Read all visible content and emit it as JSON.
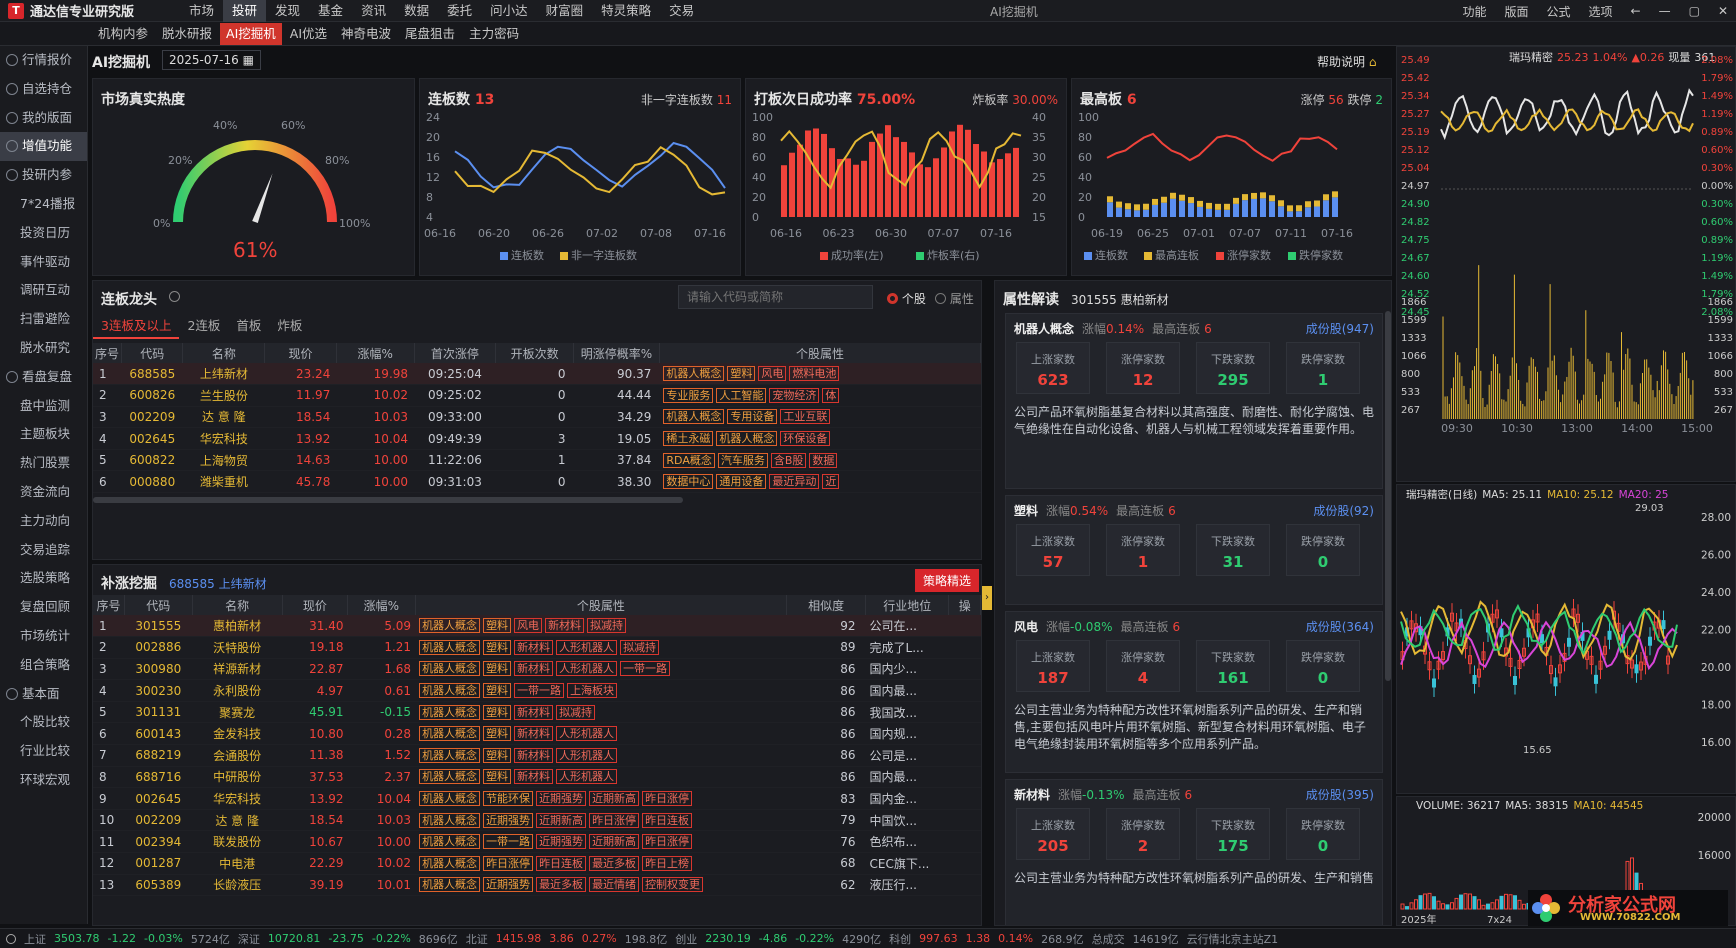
{
  "app": {
    "name": "通达信专业研究版",
    "window_title": "AI挖掘机",
    "menu": [
      "市场",
      "投研",
      "发现",
      "基金",
      "资讯",
      "数据",
      "委托",
      "问小达",
      "财富圈",
      "特灵策略",
      "交易"
    ],
    "menu_active": "投研",
    "right_menu": [
      "功能",
      "版面",
      "公式",
      "选项"
    ]
  },
  "subtabs": [
    "机构内参",
    "脱水研报",
    "AI挖掘机",
    "AI优选",
    "神奇电波",
    "尾盘狙击",
    "主力密码"
  ],
  "subtab_active": "AI挖掘机",
  "sidebar": [
    {
      "label": "行情报价",
      "group": true,
      "icon": "chart-icon"
    },
    {
      "label": "自选持仓",
      "group": true,
      "icon": "star-icon"
    },
    {
      "label": "我的版面",
      "group": true,
      "icon": "layout-icon"
    },
    {
      "label": "增值功能",
      "group": true,
      "icon": "plus-icon",
      "active": true
    },
    {
      "label": "投研内参",
      "group": true,
      "icon": "research-icon"
    },
    {
      "label": "7*24播报"
    },
    {
      "label": "投资日历"
    },
    {
      "label": "事件驱动"
    },
    {
      "label": "调研互动"
    },
    {
      "label": "扫雷避险"
    },
    {
      "label": "脱水研究"
    },
    {
      "label": "看盘复盘",
      "group": true,
      "icon": "review-icon"
    },
    {
      "label": "盘中监测"
    },
    {
      "label": "主题板块"
    },
    {
      "label": "热门股票"
    },
    {
      "label": "资金流向"
    },
    {
      "label": "主力动向"
    },
    {
      "label": "交易追踪"
    },
    {
      "label": "选股策略"
    },
    {
      "label": "复盘回顾"
    },
    {
      "label": "市场统计"
    },
    {
      "label": "组合策略"
    },
    {
      "label": "基本面",
      "group": true,
      "icon": "fundamental-icon"
    },
    {
      "label": "个股比较"
    },
    {
      "label": "行业比较"
    },
    {
      "label": "环球宏观"
    }
  ],
  "toolbar": {
    "title": "AI挖掘机",
    "date": "2025-07-16",
    "help": "帮助说明"
  },
  "heat": {
    "title": "市场真实热度",
    "value": "61%",
    "value_num": 61,
    "ticks": [
      "0%",
      "20%",
      "40%",
      "60%",
      "80%",
      "100%"
    ]
  },
  "lianban": {
    "title": "连板数",
    "count": "13",
    "sub_label": "非一字连板数",
    "sub_count": "11",
    "y_ticks": [
      "24",
      "20",
      "16",
      "12",
      "8",
      "4"
    ],
    "x_ticks": [
      "06-16",
      "06-20",
      "06-26",
      "07-02",
      "07-08",
      "07-16"
    ],
    "legend": [
      "连板数",
      "非一字连板数"
    ]
  },
  "daban": {
    "title": "打板次日成功率",
    "rate": "75.00%",
    "sub_label": "炸板率",
    "sub_rate": "30.00%",
    "y_left": [
      "100",
      "80",
      "60",
      "40",
      "20",
      "0"
    ],
    "y_right": [
      "40",
      "35",
      "30",
      "25",
      "20",
      "15"
    ],
    "x_ticks": [
      "06-16",
      "06-23",
      "06-30",
      "07-07",
      "07-16"
    ],
    "legend": [
      "成功率(左)",
      "炸板率(右)"
    ]
  },
  "zuigao": {
    "title": "最高板",
    "value": "6",
    "up_label": "涨停",
    "up": "56",
    "down_label": "跌停",
    "down": "2",
    "y_ticks": [
      "100",
      "80",
      "60",
      "40",
      "20",
      "0"
    ],
    "x_ticks": [
      "06-19",
      "06-25",
      "07-01",
      "07-07",
      "07-11",
      "07-16"
    ],
    "legend": [
      "连板数",
      "最高连板",
      "涨停家数",
      "跌停家数"
    ]
  },
  "dragon": {
    "title": "连板龙头",
    "search_placeholder": "请输入代码或简称",
    "radio": [
      "个股",
      "属性"
    ],
    "tabs": [
      "3连板及以上",
      "2连板",
      "首板",
      "炸板"
    ],
    "columns": [
      "序号",
      "代码",
      "名称",
      "现价",
      "涨幅%",
      "首次涨停",
      "开板次数",
      "明涨停概率%",
      "个股属性"
    ],
    "rows": [
      {
        "n": "1",
        "code": "688585",
        "name": "上纬新材",
        "price": "23.24",
        "pct": "19.98",
        "first": "09:25:04",
        "open": "0",
        "prob": "90.37",
        "tags": [
          "机器人概念",
          "塑料",
          "风电",
          "燃料电池"
        ]
      },
      {
        "n": "2",
        "code": "600826",
        "name": "兰生股份",
        "price": "11.97",
        "pct": "10.02",
        "first": "09:25:02",
        "open": "0",
        "prob": "44.44",
        "tags": [
          "专业服务",
          "人工智能",
          "宠物经济",
          "体"
        ]
      },
      {
        "n": "3",
        "code": "002209",
        "name": "达 意 隆",
        "price": "18.54",
        "pct": "10.03",
        "first": "09:33:00",
        "open": "0",
        "prob": "34.29",
        "tags": [
          "机器人概念",
          "专用设备",
          "工业互联"
        ]
      },
      {
        "n": "4",
        "code": "002645",
        "name": "华宏科技",
        "price": "13.92",
        "pct": "10.04",
        "first": "09:49:39",
        "open": "3",
        "prob": "19.05",
        "tags": [
          "稀土永磁",
          "机器人概念",
          "环保设备"
        ]
      },
      {
        "n": "5",
        "code": "600822",
        "name": "上海物贸",
        "price": "14.63",
        "pct": "10.00",
        "first": "11:22:06",
        "open": "1",
        "prob": "37.84",
        "tags": [
          "RDA概念",
          "汽车服务",
          "含B股",
          "数据"
        ]
      },
      {
        "n": "6",
        "code": "000880",
        "name": "潍柴重机",
        "price": "45.78",
        "pct": "10.00",
        "first": "09:31:03",
        "open": "0",
        "prob": "38.30",
        "tags": [
          "数据中心",
          "通用设备",
          "最近异动",
          "近"
        ]
      }
    ]
  },
  "buzhang": {
    "title": "补涨挖掘",
    "ref_code": "688585",
    "ref_name": "上纬新材",
    "button": "策略精选",
    "columns": [
      "序号",
      "代码",
      "名称",
      "现价",
      "涨幅%",
      "个股属性",
      "相似度",
      "行业地位",
      "操"
    ],
    "rows": [
      {
        "n": "1",
        "code": "301555",
        "name": "惠柏新材",
        "price": "31.40",
        "pct": "5.09",
        "tags": [
          "机器人概念",
          "塑料",
          "风电",
          "新材料",
          "拟减持"
        ],
        "sim": "92",
        "pos": "公司在..."
      },
      {
        "n": "2",
        "code": "002886",
        "name": "沃特股份",
        "price": "19.18",
        "pct": "1.21",
        "tags": [
          "机器人概念",
          "塑料",
          "新材料",
          "人形机器人",
          "拟减持"
        ],
        "sim": "89",
        "pos": "完成了L..."
      },
      {
        "n": "3",
        "code": "300980",
        "name": "祥源新材",
        "price": "22.87",
        "pct": "1.68",
        "tags": [
          "机器人概念",
          "塑料",
          "新材料",
          "人形机器人",
          "一带一路"
        ],
        "sim": "86",
        "pos": "国内少..."
      },
      {
        "n": "4",
        "code": "300230",
        "name": "永利股份",
        "price": "4.97",
        "pct": "0.61",
        "tags": [
          "机器人概念",
          "塑料",
          "一带一路",
          "上海板块"
        ],
        "sim": "86",
        "pos": "国内最..."
      },
      {
        "n": "5",
        "code": "301131",
        "name": "聚赛龙",
        "price": "45.91",
        "pct": "-0.15",
        "tags": [
          "机器人概念",
          "塑料",
          "新材料",
          "拟减持"
        ],
        "sim": "86",
        "pos": "我国改..."
      },
      {
        "n": "6",
        "code": "600143",
        "name": "金发科技",
        "price": "10.80",
        "pct": "0.28",
        "tags": [
          "机器人概念",
          "塑料",
          "新材料",
          "人形机器人"
        ],
        "sim": "86",
        "pos": "国内规..."
      },
      {
        "n": "7",
        "code": "688219",
        "name": "会通股份",
        "price": "11.38",
        "pct": "1.52",
        "tags": [
          "机器人概念",
          "塑料",
          "新材料",
          "人形机器人"
        ],
        "sim": "86",
        "pos": "公司是..."
      },
      {
        "n": "8",
        "code": "688716",
        "name": "中研股份",
        "price": "37.53",
        "pct": "2.37",
        "tags": [
          "机器人概念",
          "塑料",
          "新材料",
          "人形机器人"
        ],
        "sim": "86",
        "pos": "国内最..."
      },
      {
        "n": "9",
        "code": "002645",
        "name": "华宏科技",
        "price": "13.92",
        "pct": "10.04",
        "tags": [
          "机器人概念",
          "节能环保",
          "近期强势",
          "近期新高",
          "昨日涨停"
        ],
        "sim": "83",
        "pos": "国内金..."
      },
      {
        "n": "10",
        "code": "002209",
        "name": "达 意 隆",
        "price": "18.54",
        "pct": "10.03",
        "tags": [
          "机器人概念",
          "近期强势",
          "近期新高",
          "昨日涨停",
          "昨日连板"
        ],
        "sim": "79",
        "pos": "中国饮..."
      },
      {
        "n": "11",
        "code": "002394",
        "name": "联发股份",
        "price": "10.67",
        "pct": "10.00",
        "tags": [
          "机器人概念",
          "一带一路",
          "近期强势",
          "近期新高",
          "昨日涨停"
        ],
        "sim": "76",
        "pos": "色织布..."
      },
      {
        "n": "12",
        "code": "001287",
        "name": "中电港",
        "price": "22.29",
        "pct": "10.02",
        "tags": [
          "机器人概念",
          "昨日涨停",
          "昨日连板",
          "最近多板",
          "昨日上榜"
        ],
        "sim": "68",
        "pos": "CEC旗下..."
      },
      {
        "n": "13",
        "code": "605389",
        "name": "长龄液压",
        "price": "39.19",
        "pct": "10.01",
        "tags": [
          "机器人概念",
          "近期强势",
          "最近多板",
          "最近情绪",
          "控制权变更"
        ],
        "sim": "62",
        "pos": "液压行..."
      }
    ]
  },
  "attr": {
    "title": "属性解读",
    "code": "301555",
    "name": "惠柏新材",
    "stat_labels": [
      "上涨家数",
      "涨停家数",
      "下跌家数",
      "跌停家数"
    ],
    "blocks": [
      {
        "name": "机器人概念",
        "pct_label": "涨幅",
        "pct": "0.14%",
        "high_label": "最高连板",
        "high": "6",
        "link": "成份股(947)",
        "stats": [
          "623",
          "12",
          "295",
          "1"
        ],
        "desc": "公司产品环氧树脂基复合材料以其高强度、耐磨性、耐化学腐蚀、电气绝缘性在自动化设备、机器人与机械工程领域发挥着重要作用。"
      },
      {
        "name": "塑料",
        "pct_label": "涨幅",
        "pct": "0.54%",
        "high_label": "最高连板",
        "high": "6",
        "link": "成份股(92)",
        "stats": [
          "57",
          "1",
          "31",
          "0"
        ],
        "desc": ""
      },
      {
        "name": "风电",
        "pct_label": "涨幅",
        "pct": "-0.08%",
        "high_label": "最高连板",
        "high": "6",
        "link": "成份股(364)",
        "stats": [
          "187",
          "4",
          "161",
          "0"
        ],
        "desc": "公司主营业务为特种配方改性环氧树脂系列产品的研发、生产和销售,主要包括风电叶片用环氧树脂、新型复合材料用环氧树脂、电子电气绝缘封装用环氧树脂等多个应用系列产品。"
      },
      {
        "name": "新材料",
        "pct_label": "涨幅",
        "pct": "-0.13%",
        "high_label": "最高连板",
        "high": "6",
        "link": "成份股(395)",
        "stats": [
          "205",
          "2",
          "175",
          "0"
        ],
        "desc": "公司主营业务为特种配方改性环氧树脂系列产品的研发、生产和销售"
      }
    ]
  },
  "intraday": {
    "name": "瑞玛精密",
    "price": "25.23",
    "pct": "1.04%",
    "chg": "▲0.26",
    "vol_label": "现量",
    "vol": "361",
    "y_left": [
      "25.49",
      "25.42",
      "25.34",
      "25.27",
      "25.19",
      "25.12",
      "25.04",
      "24.97",
      "24.90",
      "24.82",
      "24.75",
      "24.67",
      "24.60",
      "24.52",
      "24.45"
    ],
    "y_right": [
      "2.08%",
      "1.79%",
      "1.49%",
      "1.19%",
      "0.89%",
      "0.60%",
      "0.30%",
      "0.00%",
      "0.30%",
      "0.60%",
      "0.89%",
      "1.19%",
      "1.49%",
      "1.79%",
      "2.08%"
    ],
    "vol_ticks": [
      "1866",
      "1599",
      "1333",
      "1066",
      "800",
      "533",
      "267"
    ],
    "x_ticks": [
      "09:30",
      "10:30",
      "13:00",
      "14:00",
      "15:00"
    ]
  },
  "daily": {
    "title": "瑞玛精密(日线)",
    "ma5": "MA5: 25.11",
    "ma10": "MA10: 25.12",
    "ma20": "MA20: 25",
    "y_ticks": [
      "28.00",
      "26.00",
      "24.00",
      "22.00",
      "20.00",
      "18.00",
      "16.00"
    ],
    "high": "29.03",
    "low": "15.65"
  },
  "volume": {
    "label": "VOLUME: 36217",
    "ma5": "MA5: 38315",
    "ma10": "MA10: 44545",
    "y_ticks": [
      "20000",
      "16000"
    ],
    "year": "2025年",
    "period": "7x24"
  },
  "statusbar": [
    {
      "text": "上证",
      "c": "grey"
    },
    {
      "text": "3503.78",
      "c": "green"
    },
    {
      "text": "-1.22",
      "c": "green"
    },
    {
      "text": "-0.03%",
      "c": "green"
    },
    {
      "text": "5724亿",
      "c": "grey"
    },
    {
      "text": "深证",
      "c": "grey"
    },
    {
      "text": "10720.81",
      "c": "green"
    },
    {
      "text": "-23.75",
      "c": "green"
    },
    {
      "text": "-0.22%",
      "c": "green"
    },
    {
      "text": "8696亿",
      "c": "grey"
    },
    {
      "text": "北证",
      "c": "grey"
    },
    {
      "text": "1415.98",
      "c": "red"
    },
    {
      "text": "3.86",
      "c": "red"
    },
    {
      "text": "0.27%",
      "c": "red"
    },
    {
      "text": "198.8亿",
      "c": "grey"
    },
    {
      "text": "创业",
      "c": "grey"
    },
    {
      "text": "2230.19",
      "c": "green"
    },
    {
      "text": "-4.86",
      "c": "green"
    },
    {
      "text": "-0.22%",
      "c": "green"
    },
    {
      "text": "4290亿",
      "c": "grey"
    },
    {
      "text": "科创",
      "c": "grey"
    },
    {
      "text": "997.63",
      "c": "red"
    },
    {
      "text": "1.38",
      "c": "red"
    },
    {
      "text": "0.14%",
      "c": "red"
    },
    {
      "text": "268.9亿",
      "c": "grey"
    },
    {
      "text": "总成交",
      "c": "grey"
    },
    {
      "text": "14619亿",
      "c": "grey"
    },
    {
      "text": "云行情北京主站Z1",
      "c": "grey"
    }
  ],
  "watermark": {
    "text": "分析家公式网",
    "url": "WWW.70822.COM"
  },
  "colors": {
    "up": "#f0433b",
    "down": "#2fcc71",
    "accent": "#d0352c",
    "yellow": "#e5b935",
    "blue": "#5b8ff0"
  }
}
